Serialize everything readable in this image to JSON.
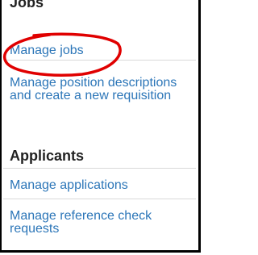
{
  "sections": {
    "jobs": {
      "heading": "Jobs",
      "links": {
        "manage_jobs": "Manage jobs",
        "position_descriptions": "Manage position descriptions and create a new requisition"
      }
    },
    "applicants": {
      "heading": "Applicants",
      "links": {
        "manage_applications": "Manage applications",
        "reference_check": "Manage reference check requests"
      }
    }
  },
  "colors": {
    "link": "#2c76b8",
    "heading": "#222222",
    "annotation": "#e00000",
    "border": "#000000"
  }
}
